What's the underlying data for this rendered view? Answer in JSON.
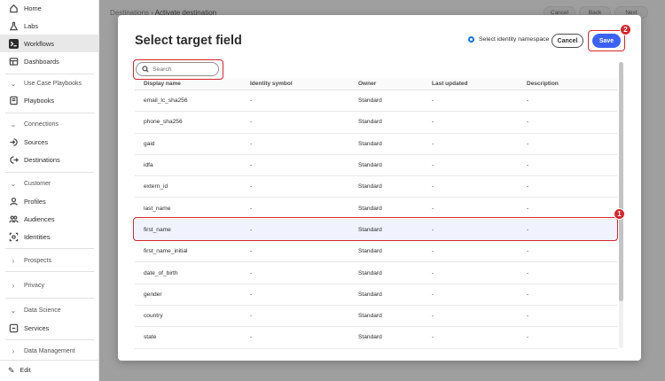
{
  "sidebar": {
    "items": [
      {
        "label": "Home",
        "icon": "home-icon"
      },
      {
        "label": "Labs",
        "icon": "labs-icon"
      },
      {
        "label": "Workflows",
        "icon": "workflows-icon"
      },
      {
        "label": "Dashboards",
        "icon": "dashboards-icon"
      }
    ],
    "use_case_section": "Use Case Playbooks",
    "playbooks": "Playbooks",
    "connections_section": "Connections",
    "sources": "Sources",
    "destinations": "Destinations",
    "customer_section": "Customer",
    "profiles": "Profiles",
    "audiences": "Audiences",
    "identities": "Identities",
    "prospects_section": "Prospects",
    "privacy_section": "Privacy",
    "data_science_section": "Data Science",
    "services": "Services",
    "data_management_section": "Data Management",
    "edit": "Edit"
  },
  "background": {
    "breadcrumb_parent": "Destinations",
    "breadcrumb_sep": "›",
    "breadcrumb_current": "Activate destination",
    "cancel": "Cancel",
    "back": "Back",
    "next": "Next"
  },
  "modal": {
    "title": "Select target field",
    "namespace_option": "Select identity namespace",
    "cancel_label": "Cancel",
    "save_label": "Save",
    "search_placeholder": "Search",
    "columns": [
      "Display name",
      "Identity symbol",
      "Owner",
      "Last updated",
      "Description"
    ],
    "rows": [
      [
        "email_lc_sha256",
        "-",
        "Standard",
        "-",
        "-"
      ],
      [
        "phone_sha256",
        "-",
        "Standard",
        "-",
        "-"
      ],
      [
        "gaid",
        "-",
        "Standard",
        "-",
        "-"
      ],
      [
        "idfa",
        "-",
        "Standard",
        "-",
        "-"
      ],
      [
        "extern_id",
        "-",
        "Standard",
        "-",
        "-"
      ],
      [
        "last_name",
        "-",
        "Standard",
        "-",
        "-"
      ],
      [
        "first_name",
        "-",
        "Standard",
        "-",
        "-"
      ],
      [
        "first_name_initial",
        "-",
        "Standard",
        "-",
        "-"
      ],
      [
        "date_of_birth",
        "-",
        "Standard",
        "-",
        "-"
      ],
      [
        "gender",
        "-",
        "Standard",
        "-",
        "-"
      ],
      [
        "country",
        "-",
        "Standard",
        "-",
        "-"
      ],
      [
        "state",
        "-",
        "Standard",
        "-",
        "-"
      ]
    ],
    "selected_row": 6
  },
  "callouts": {
    "one": "1",
    "two": "2"
  },
  "colors": {
    "accent": "#3b63fb",
    "callout": "#d7262c",
    "radio": "#1473e6"
  }
}
